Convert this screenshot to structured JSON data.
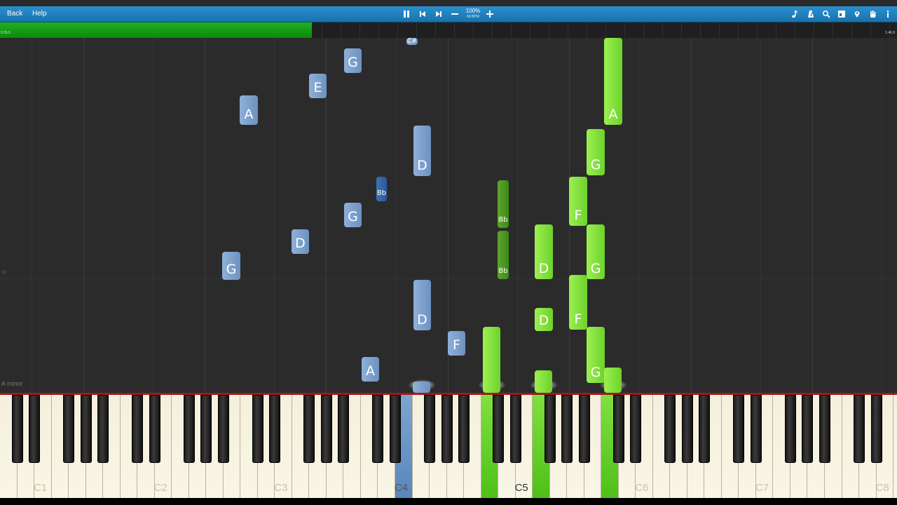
{
  "toolbar": {
    "back_label": "Back",
    "help_label": "Help",
    "zoom_value": "100%",
    "tempo": "69 BPM",
    "icons": [
      "pause-icon",
      "previous-icon",
      "next-icon",
      "minus-icon",
      "plus-icon",
      "note-icon",
      "metronome-icon",
      "search-icon",
      "square-icon",
      "location-icon",
      "hand-icon",
      "info-icon"
    ]
  },
  "progress": {
    "elapsed": "0:35.5",
    "total": "1:46.9",
    "fraction": 0.348,
    "color": "#14a314"
  },
  "roll": {
    "key_signature": "A minor",
    "bar_number": "16",
    "notes": [
      {
        "label": "G",
        "hand": "left"
      },
      {
        "label": "E",
        "hand": "left"
      },
      {
        "label": "A",
        "hand": "left"
      },
      {
        "label": "C#",
        "hand": "left"
      },
      {
        "label": "D",
        "hand": "left"
      },
      {
        "label": "Bb",
        "hand": "left"
      },
      {
        "label": "G",
        "hand": "left"
      },
      {
        "label": "D",
        "hand": "left"
      },
      {
        "label": "G",
        "hand": "left"
      },
      {
        "label": "D",
        "hand": "left"
      },
      {
        "label": "F",
        "hand": "left"
      },
      {
        "label": "A",
        "hand": "left"
      },
      {
        "label": "A",
        "hand": "right"
      },
      {
        "label": "G",
        "hand": "right"
      },
      {
        "label": "F",
        "hand": "right"
      },
      {
        "label": "Bb",
        "hand": "right"
      },
      {
        "label": "Bb",
        "hand": "right"
      },
      {
        "label": "D",
        "hand": "right"
      },
      {
        "label": "G",
        "hand": "right"
      },
      {
        "label": "F",
        "hand": "right"
      },
      {
        "label": "D",
        "hand": "right"
      },
      {
        "label": "G",
        "hand": "right"
      }
    ]
  },
  "keyboard": {
    "octave_labels": [
      "C1",
      "C2",
      "C3",
      "C4",
      "C5",
      "C6",
      "C7",
      "C8"
    ],
    "left_hand_color": "#6d92c0",
    "right_hand_color": "#6dd22c"
  }
}
